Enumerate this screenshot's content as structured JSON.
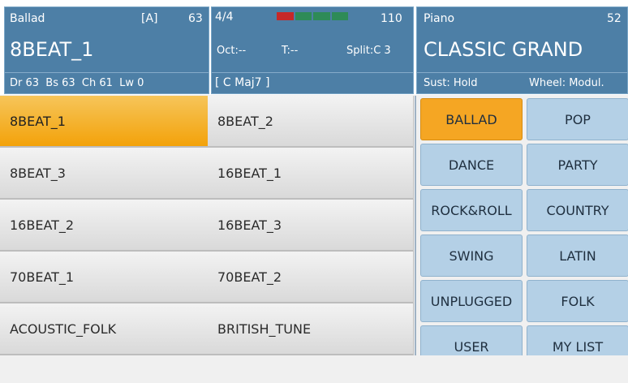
{
  "header": {
    "style": {
      "category": "Ballad",
      "variation": "[A]",
      "number": "63",
      "name": "8BEAT_1",
      "volumes": "Dr 63  Bs 63  Ch 61  Lw 0"
    },
    "arranger": {
      "meter": "4/4",
      "tempo": "110",
      "octave": "Oct:--",
      "transpose": "T:--",
      "split": "Split:C 3",
      "chord": "[ C Maj7 ]",
      "beat_colors": [
        "#c62828",
        "#2e8b57",
        "#2e8b57",
        "#2e8b57"
      ]
    },
    "sound": {
      "category": "Piano",
      "number": "52",
      "name": "CLASSIC GRAND",
      "sustain": "Sust: Hold",
      "wheel": "Wheel: Modul."
    }
  },
  "styles": [
    "8BEAT_1",
    "8BEAT_2",
    "8BEAT_3",
    "16BEAT_1",
    "16BEAT_2",
    "16BEAT_3",
    "70BEAT_1",
    "70BEAT_2",
    "ACOUSTIC_FOLK",
    "BRITISH_TUNE"
  ],
  "selected_style": "8BEAT_1",
  "categories": [
    "BALLAD",
    "POP",
    "DANCE",
    "PARTY",
    "ROCK&ROLL",
    "COUNTRY",
    "SWING",
    "LATIN",
    "UNPLUGGED",
    "FOLK",
    "USER",
    "MY LIST"
  ],
  "selected_category": "BALLAD",
  "colors": {
    "panel_bg": "#4d7fa6",
    "selected": "#f5a623",
    "category_bg": "#b4d0e6"
  }
}
